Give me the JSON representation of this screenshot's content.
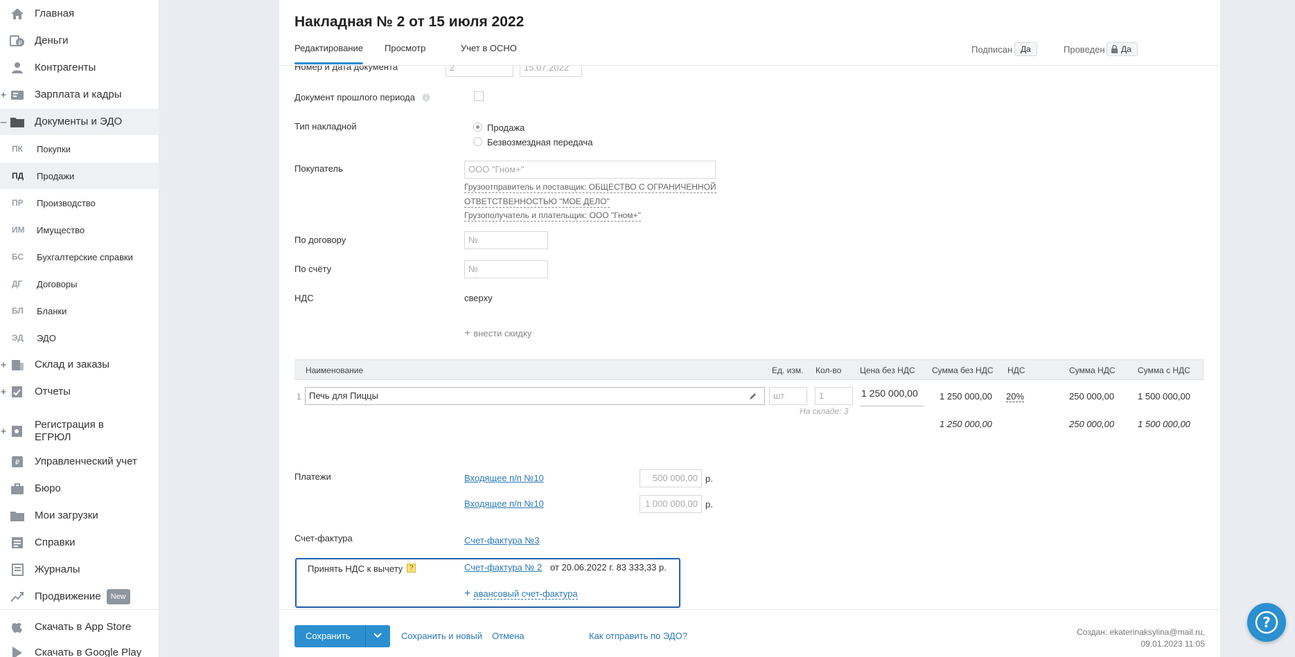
{
  "sidebar": {
    "nav": [
      {
        "label": "Главная",
        "icon": "home-icon",
        "expander": ""
      },
      {
        "label": "Деньги",
        "icon": "money-icon",
        "expander": ""
      },
      {
        "label": "Контрагенты",
        "icon": "contractors-icon",
        "expander": ""
      },
      {
        "label": "Зарплата и кадры",
        "icon": "salary-icon",
        "expander": "+"
      },
      {
        "label": "Документы и ЭДО",
        "icon": "folder-icon",
        "expander": "–"
      }
    ],
    "sub": [
      {
        "code": "ПК",
        "label": "Покупки"
      },
      {
        "code": "ПД",
        "label": "Продажи"
      },
      {
        "code": "ПР",
        "label": "Производство"
      },
      {
        "code": "ИМ",
        "label": "Имущество"
      },
      {
        "code": "БС",
        "label": "Бухгалтерские справки"
      },
      {
        "code": "ДГ",
        "label": "Договоры"
      },
      {
        "code": "БЛ",
        "label": "Бланки"
      },
      {
        "code": "ЭД",
        "label": "ЭДО"
      }
    ],
    "nav2": [
      {
        "label": "Склад и заказы",
        "expander": "+"
      },
      {
        "label": "Отчеты",
        "expander": "+"
      },
      {
        "label": "Регистрация в ЕГРЮЛ",
        "expander": "+"
      },
      {
        "label": "Управленческий учет",
        "expander": ""
      },
      {
        "label": "Бюро",
        "expander": ""
      },
      {
        "label": "Мои загрузки",
        "expander": ""
      },
      {
        "label": "Справки",
        "expander": ""
      },
      {
        "label": "Журналы",
        "expander": ""
      },
      {
        "label": "Продвижение",
        "expander": "",
        "badge": "New"
      }
    ],
    "bottom": [
      {
        "label": "Скачать в App Store"
      },
      {
        "label": "Скачать в Google Play"
      }
    ]
  },
  "page": {
    "title": "Накладная № 2 от 15 июля 2022",
    "tabs": [
      "Редактирование",
      "Просмотр",
      "Учет в ОСНО"
    ],
    "signed_label": "Подписан",
    "signed_value": "Да",
    "posted_label": "Проведен",
    "posted_value": "Да"
  },
  "form": {
    "doc_number_label": "Номер и дата документа",
    "doc_number": "2",
    "doc_date": "15.07.2022",
    "past_period_label": "Документ прошлого периода",
    "type_label": "Тип накладной",
    "type_sale": "Продажа",
    "type_free": "Безвозмездная передача",
    "buyer_label": "Покупатель",
    "buyer_value": "ООО \"Гном+\"",
    "shipper_line1": "Грузоотправитель и поставщик: ОБЩЕСТВО С ОГРАНИЧЕННОЙ",
    "shipper_line2": "ОТВЕТСТВЕННОСТЬЮ \"МОЕ ДЕЛО\"",
    "consignee": "Грузополучатель и плательщик: ООО \"Гном+\"",
    "contract_label": "По договору",
    "contract_placeholder": "№",
    "invoice_label": "По счёту",
    "invoice_placeholder": "№",
    "vat_label": "НДС",
    "vat_value": "сверху",
    "discount_link": "внести скидку"
  },
  "table": {
    "headers": [
      "Наименование",
      "Ед. изм.",
      "Кол-во",
      "Цена без НДС",
      "Сумма без НДС",
      "НДС",
      "Сумма НДС",
      "Сумма с НДС"
    ],
    "row": {
      "num": "1",
      "name": "Печь для Пиццы",
      "unit": "шт",
      "qty": "1",
      "stock": "На складе: 3",
      "price": "1 250 000,00",
      "sum_no_vat": "1 250 000,00",
      "vat_rate": "20%",
      "vat_sum": "250 000,00",
      "sum_with_vat": "1 500 000,00"
    },
    "totals": {
      "sum_no_vat": "1 250 000,00",
      "vat_sum": "250 000,00",
      "sum_with_vat": "1 500 000,00"
    }
  },
  "payments": {
    "label": "Платежи",
    "items": [
      {
        "link": "Входящее п/п №10",
        "amount": "500 000,00",
        "currency": "р."
      },
      {
        "link": "Входящее п/п №10",
        "amount": "1 000 000,00",
        "currency": "р."
      }
    ]
  },
  "invoice_section": {
    "label": "Счет-фактура",
    "link": "Счет-фактура №3"
  },
  "vat_deduction": {
    "label": "Принять НДС к вычету",
    "hint": "?",
    "link": "Счет-фактура № 2",
    "details": "от 20.06.2022 г. 83 333,33 р.",
    "add_link": "авансовый счет-фактура"
  },
  "footer": {
    "save": "Сохранить",
    "save_new": "Сохранить и новый",
    "cancel": "Отмена",
    "edo_link": "Как отправить по ЭДО?",
    "created_line1": "Создан: ekaterinaksylina@mail.ru,",
    "created_line2": "09.01.2023 11:05"
  },
  "colors": {
    "accent": "#2b8fd0",
    "link": "#2b7bb9",
    "highlight_border": "#1f5fa8"
  }
}
